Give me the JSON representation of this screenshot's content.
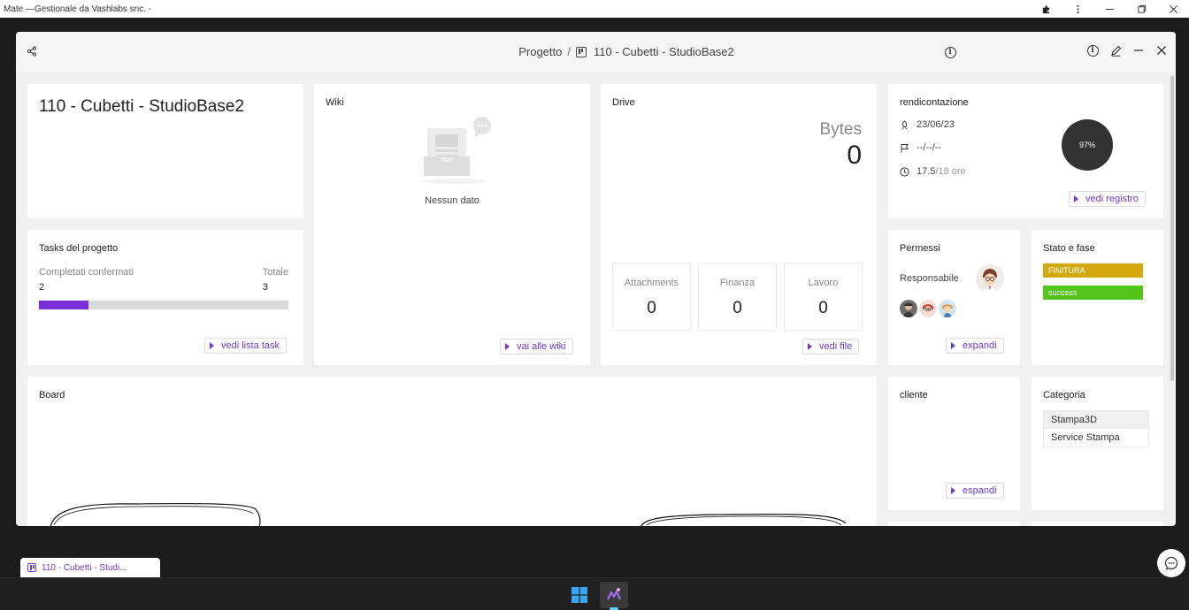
{
  "os": {
    "title": "Mate —Gestionale da Vashlabs snc. -"
  },
  "modal": {
    "breadcrumb_root": "Progetto",
    "breadcrumb_sep": "/",
    "breadcrumb_current": "110 - Cubetti - StudioBase2"
  },
  "project": {
    "title": "110 - Cubetti - StudioBase2"
  },
  "tasks": {
    "title": "Tasks del progetto",
    "completed_label": "Completati confermati",
    "total_label": "Totale",
    "completed": "2",
    "total": "3",
    "progress_fraction": 0.2,
    "button": "vedi lista task"
  },
  "wiki": {
    "title": "Wiki",
    "empty_text": "Nessun dato",
    "button": "vai alle wiki"
  },
  "drive": {
    "title": "Drive",
    "bytes_label": "Bytes",
    "bytes_value": "0",
    "stats": [
      {
        "label": "Attachments",
        "value": "0"
      },
      {
        "label": "Finanza",
        "value": "0"
      },
      {
        "label": "Lavoro",
        "value": "0"
      }
    ],
    "button": "vedi file"
  },
  "rendicontazione": {
    "title": "rendicontazione",
    "start_date": "23/06/23",
    "end_date": "--/--/--",
    "hours_done": "17.5",
    "hours_total": "/18 ore",
    "percent": "97%",
    "button": "vedi registro"
  },
  "permessi": {
    "title": "Permessi",
    "responsabile_label": "Responsabile",
    "button": "expandi"
  },
  "stato": {
    "title": "Stato e fase",
    "phase": "FINITURA",
    "phase_color": "#d4a90f",
    "status": "success",
    "status_color": "#52c41a"
  },
  "board": {
    "title": "Board"
  },
  "cliente": {
    "title": "cliente",
    "button": "espandi"
  },
  "categoria": {
    "title": "Categoria",
    "items": [
      "Stampa3D",
      "Service Stampa"
    ]
  },
  "taskbar_tab": {
    "label": "110 - Cubetti - Studi..."
  },
  "colors": {
    "accent": "#6f3bd1",
    "progress": "#7b2fd8"
  }
}
